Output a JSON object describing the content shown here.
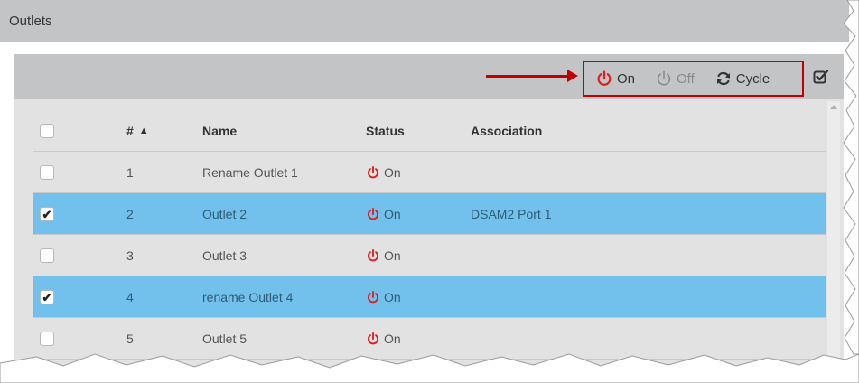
{
  "header": {
    "title": "Outlets"
  },
  "toolbar": {
    "on_label": "On",
    "off_label": "Off",
    "cycle_label": "Cycle",
    "accent_color": "#c00000"
  },
  "table": {
    "columns": {
      "number": "#",
      "name": "Name",
      "status": "Status",
      "association": "Association"
    },
    "rows": [
      {
        "number": "1",
        "name": "Rename Outlet 1",
        "status": "On",
        "association": "",
        "selected": false
      },
      {
        "number": "2",
        "name": "Outlet 2",
        "status": "On",
        "association": "DSAM2 Port 1",
        "selected": true
      },
      {
        "number": "3",
        "name": "Outlet 3",
        "status": "On",
        "association": "",
        "selected": false
      },
      {
        "number": "4",
        "name": "rename Outlet 4",
        "status": "On",
        "association": "",
        "selected": true
      },
      {
        "number": "5",
        "name": "Outlet 5",
        "status": "On",
        "association": "",
        "selected": false
      }
    ]
  },
  "icons": {
    "on": "power-icon",
    "off": "power-icon",
    "cycle": "refresh-icon",
    "toolbar_extra": "check-square-icon",
    "sort": "sort-ascending-icon"
  },
  "colors": {
    "selected_row": "#72c1ec",
    "power_on": "#e02020",
    "power_off": "#8a8a8a"
  }
}
